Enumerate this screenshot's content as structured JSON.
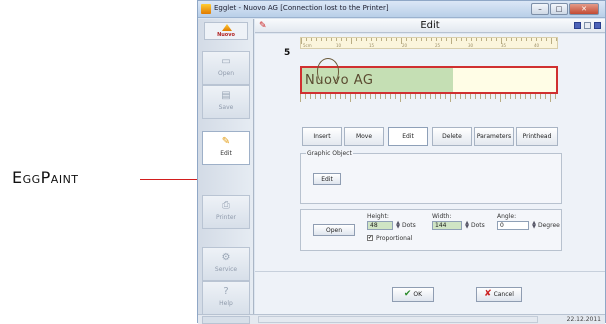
{
  "callout": {
    "label": "EggPaint",
    "accent": "#d21e1e"
  },
  "window": {
    "title": "Egglet - Nuovo AG   [Connection lost to the Printer]",
    "controls": {
      "minimize": "–",
      "maximize": "□",
      "close": "✕"
    }
  },
  "sidebar": {
    "logo_text": "Nuovo",
    "items": [
      {
        "label": "Open",
        "icon": "folder-icon",
        "glyph": "▭"
      },
      {
        "label": "Save",
        "icon": "disk-icon",
        "glyph": "▤"
      },
      {
        "label": "Edit",
        "icon": "edit-icon",
        "glyph": "✎"
      },
      {
        "label": "Printer",
        "icon": "printer-icon",
        "glyph": "⎙"
      },
      {
        "label": "Service",
        "icon": "gear-icon",
        "glyph": "⚙"
      },
      {
        "label": "Help",
        "icon": "help-icon",
        "glyph": "?"
      }
    ],
    "active_item": "Edit"
  },
  "header": {
    "title": "Edit"
  },
  "editor": {
    "row_number": "5",
    "label_text": "Nuovo AG",
    "ruler_marks": [
      "5cm",
      "10",
      "15",
      "20",
      "25",
      "30",
      "35",
      "40"
    ]
  },
  "tabs": [
    "Insert",
    "Move",
    "Edit",
    "Delete",
    "Parameters",
    "Printhead"
  ],
  "selected_tab": "Edit",
  "graphic_object": {
    "group_label": "Graphic Object",
    "edit_button": "Edit"
  },
  "params": {
    "open_button": "Open",
    "height_label": "Height:",
    "height_value": "48",
    "width_label": "Width:",
    "width_value": "144",
    "angle_label": "Angle:",
    "angle_value": "0",
    "dots_unit": "Dots",
    "degree_unit": "Degree",
    "proportional_label": "Proportional",
    "proportional_checked": "✔"
  },
  "actions": {
    "ok": "OK",
    "cancel": "Cancel",
    "ok_glyph": "✔",
    "cancel_glyph": "✘"
  },
  "status": {
    "date": "22.12.2011"
  }
}
